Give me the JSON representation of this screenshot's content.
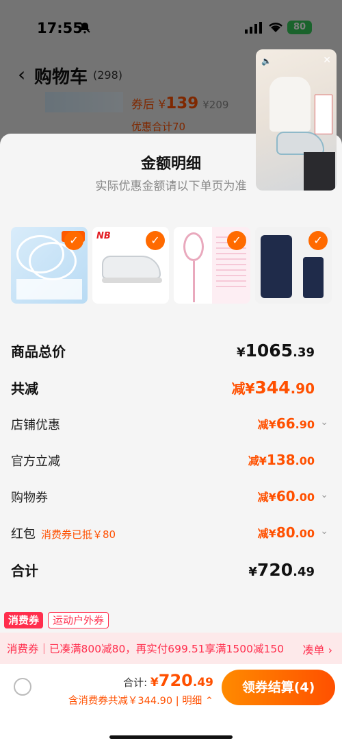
{
  "status_bar": {
    "time": "17:55",
    "battery": "80"
  },
  "nav": {
    "back_icon": "‹",
    "title": "购物车",
    "count": "(298)"
  },
  "bg_item": {
    "price_prefix": "券后 ¥",
    "price": "139",
    "orig_price": "¥209",
    "discount_total": "优惠合计70"
  },
  "sheet": {
    "title": "金额明细",
    "subtitle": "实际优惠金额请以下单页为准",
    "product_total": {
      "label": "商品总价",
      "currency": "¥",
      "value_int": "1065",
      "value_dec": ".39"
    },
    "total_reduced": {
      "label": "共减",
      "prefix": "减¥",
      "value_int": "344",
      "value_dec": ".90"
    },
    "shop_discount": {
      "label": "店铺优惠",
      "prefix": "减¥",
      "value_int": "66",
      "value_dec": ".90"
    },
    "official_discount": {
      "label": "官方立减",
      "prefix": "减¥",
      "value_int": "138",
      "value_dec": ".00"
    },
    "coupon": {
      "label": "购物券",
      "prefix": "减¥",
      "value_int": "60",
      "value_dec": ".00"
    },
    "red_packet": {
      "label": "红包",
      "note": "消费券已抵￥80",
      "prefix": "减¥",
      "value_int": "80",
      "value_dec": ".00"
    },
    "grand_total": {
      "label": "合计",
      "currency": "¥",
      "value_int": "720",
      "value_dec": ".49"
    }
  },
  "tags": {
    "tag1": "消费券",
    "tag2": "运动户外券"
  },
  "promo": {
    "text": "消费券｜已凑满800减80，再实付699.51享满1500减150",
    "link": "凑单 ›"
  },
  "bottom": {
    "total_label": "合计:",
    "total_currency": "¥",
    "total_int": "720",
    "total_dec": ".49",
    "sub_text": "含消费券共减￥344.90 | 明细 ⌃",
    "pay_button": "领券结算(4)"
  },
  "colors": {
    "accent": "#ff5000",
    "promo_red": "#ff2e4d",
    "check": "#ff6a00"
  }
}
